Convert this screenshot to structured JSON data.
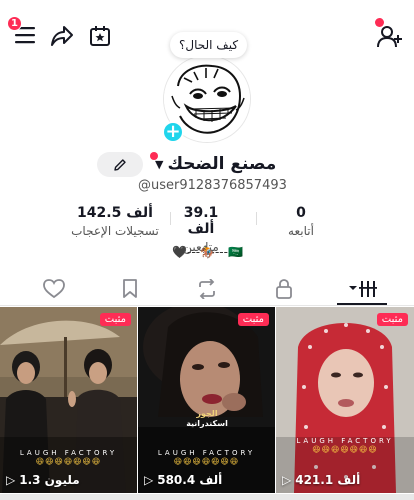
{
  "header": {
    "notification_count": "1"
  },
  "profile": {
    "status_bubble": "كيف الحال؟",
    "display_name": "مصنع الضحك",
    "username": "@user9128376857493",
    "bio": "🖤---🏇---🇸🇦"
  },
  "stats": {
    "likes_value": "142.5 ألف",
    "likes_label": "تسجيلات الإعجاب",
    "followers_value": "39.1 ألف",
    "followers_label": "متابعين",
    "following_value": "0",
    "following_label": "أتابعه"
  },
  "videos": [
    {
      "pinned_label": "مثبت",
      "views": "1.3 مليون",
      "watermark": "LAUGH FACTORY",
      "emojis": "😆😆😆😆😆😆😆"
    },
    {
      "pinned_label": "مثبت",
      "views": "580.4 ألف",
      "watermark": "LAUGH FACTORY",
      "emojis": "😆😆😆😆😆😆😆",
      "caption_line1": "الجوز",
      "caption_line2": "اسكندرانية"
    },
    {
      "pinned_label": "مثبت",
      "views": "421.1 ألف",
      "watermark": "LAUGH FACTORY",
      "emojis": "😆😆😆😆😆😆😆"
    }
  ],
  "colors": {
    "accent": "#fe2c55",
    "add_button": "#20d5ec",
    "text": "#161823"
  }
}
